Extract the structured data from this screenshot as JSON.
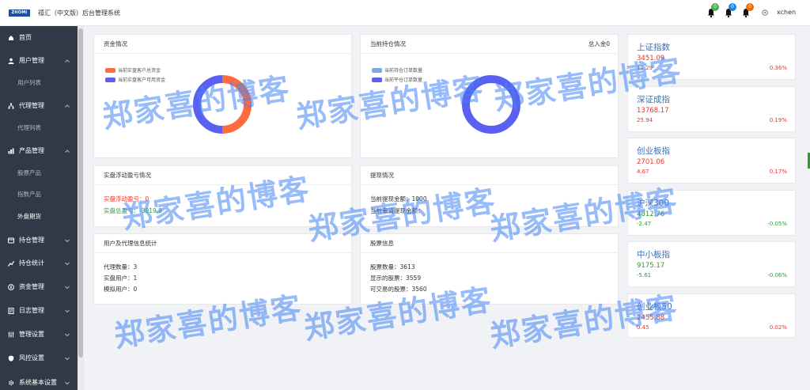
{
  "header": {
    "logo_text": "ZHOMI",
    "title": "禧汇（中文版）后台管理系统",
    "notifications": [
      {
        "count": "0",
        "color": "#4caf50"
      },
      {
        "count": "0",
        "color": "#1e88e5"
      },
      {
        "count": "0",
        "color": "#ef6c00"
      }
    ],
    "username": "xchen"
  },
  "sidebar": {
    "items": [
      {
        "label": "首页",
        "icon": "home-icon"
      },
      {
        "label": "用户管理",
        "icon": "user-icon"
      },
      {
        "label": "用户列表",
        "sub": true
      },
      {
        "label": "代理管理",
        "icon": "org-icon"
      },
      {
        "label": "代理列表",
        "sub": true
      },
      {
        "label": "产品管理",
        "icon": "chart-icon"
      },
      {
        "label": "股票产品",
        "sub": true
      },
      {
        "label": "指数产品",
        "sub": true
      },
      {
        "label": "外盘期货",
        "sub": true,
        "active": true
      },
      {
        "label": "持仓管理",
        "icon": "position-icon"
      },
      {
        "label": "持仓统计",
        "icon": "stats-icon"
      },
      {
        "label": "资金管理",
        "icon": "money-icon"
      },
      {
        "label": "日志管理",
        "icon": "log-icon"
      },
      {
        "label": "管理设置",
        "icon": "settings-icon"
      },
      {
        "label": "风控设置",
        "icon": "shield-icon"
      },
      {
        "label": "系统基本设置",
        "icon": "system-icon"
      }
    ]
  },
  "cards": {
    "funds": {
      "title": "资金情况",
      "legend": [
        "当前实盘客户总资金",
        "当前实盘客户可用资金"
      ],
      "chart_data": {
        "type": "pie",
        "categories": [
          "当前实盘客户总资金",
          "当前实盘客户可用资金"
        ],
        "values": [
          50,
          50
        ],
        "colors": [
          "#ff6b3d",
          "#5a60f2"
        ]
      }
    },
    "positions": {
      "title": "当前持仓情况",
      "extra": "总入金0",
      "legend": [
        "当前持仓订单数量",
        "当前平仓订单数量"
      ],
      "chart_data": {
        "type": "pie",
        "categories": [
          "当前持仓订单数量",
          "当前平仓订单数量"
        ],
        "values": [
          0,
          100
        ],
        "colors": [
          "#7fa8e0",
          "#5a60f2"
        ]
      }
    },
    "pnl": {
      "title": "实盘浮动盈亏情况",
      "floating_label": "实盘浮动盈亏：",
      "floating_value": "0",
      "total_label": "实盘总盈亏：",
      "total_value": "-3919.8"
    },
    "withdraw": {
      "title": "提现情况",
      "withdrawn_label": "当前提现金额：",
      "withdrawn_value": "1000",
      "pending_label": "当前审请提现金额："
    },
    "users": {
      "title": "用户及代理信息统计",
      "rows": [
        {
          "label": "代理数量：",
          "value": "3"
        },
        {
          "label": "实盘用户：",
          "value": "1"
        },
        {
          "label": "模拟用户：",
          "value": "0"
        }
      ]
    },
    "stocks": {
      "title": "股票信息",
      "rows": [
        {
          "label": "股票数量：",
          "value": "3613"
        },
        {
          "label": "显示的股票：",
          "value": "3559"
        },
        {
          "label": "可交易的股票：",
          "value": "3560"
        }
      ]
    }
  },
  "indices": [
    {
      "name": "上证指数",
      "price": "3451.09",
      "change": "12.29",
      "pct": "0.36%",
      "dir": "up"
    },
    {
      "name": "深证成指",
      "price": "13768.17",
      "change": "25.94",
      "pct": "0.19%",
      "dir": "up"
    },
    {
      "name": "创业板指",
      "price": "2701.06",
      "change": "4.67",
      "pct": "0.17%",
      "dir": "up"
    },
    {
      "name": "沪深300",
      "price": "4812.76",
      "change": "-2.47",
      "pct": "-0.05%",
      "dir": "down"
    },
    {
      "name": "中小板指",
      "price": "9175.17",
      "change": "-5.61",
      "pct": "-0.06%",
      "dir": "down"
    },
    {
      "name": "创业板50",
      "price": "2455.88",
      "change": "0.45",
      "pct": "0.02%",
      "dir": "up"
    }
  ],
  "watermark": "郑家喜的博客",
  "colors": {
    "up": "#e8332a",
    "down": "#2e9a33",
    "sidebar": "#2f3a46",
    "index_name": "#3d6fb0"
  }
}
